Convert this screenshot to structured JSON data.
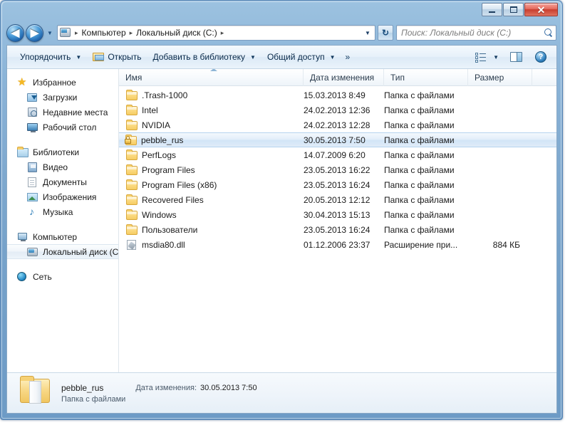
{
  "window": {
    "minimize_label": "–",
    "maximize_label": "",
    "close_label": "✕"
  },
  "address_bar": {
    "back_label": "◀",
    "forward_label": "▶",
    "recent_caret": "▼",
    "crumbs": [
      {
        "label": "Компьютер"
      },
      {
        "label": "Локальный диск (C:)"
      }
    ],
    "separator": "▸",
    "dropdown_caret": "▼",
    "refresh_label": "↻"
  },
  "search": {
    "placeholder": "Поиск: Локальный диск (C:)",
    "value": ""
  },
  "toolbar": {
    "organize_label": "Упорядочить",
    "open_label": "Открыть",
    "add_to_library_label": "Добавить в библиотеку",
    "share_label": "Общий доступ",
    "overflow_label": "»",
    "caret": "▼",
    "help_label": "?"
  },
  "navigation_pane": {
    "groups": [
      {
        "header": {
          "label": "Избранное",
          "icon": "star-icon"
        },
        "items": [
          {
            "label": "Загрузки",
            "icon": "downloads-icon"
          },
          {
            "label": "Недавние места",
            "icon": "recent-places-icon"
          },
          {
            "label": "Рабочий стол",
            "icon": "desktop-icon"
          }
        ]
      },
      {
        "header": {
          "label": "Библиотеки",
          "icon": "library-icon"
        },
        "items": [
          {
            "label": "Видео",
            "icon": "video-icon"
          },
          {
            "label": "Документы",
            "icon": "documents-icon"
          },
          {
            "label": "Изображения",
            "icon": "pictures-icon"
          },
          {
            "label": "Музыка",
            "icon": "music-icon"
          }
        ]
      },
      {
        "header": {
          "label": "Компьютер",
          "icon": "computer-icon"
        },
        "items": [
          {
            "label": "Локальный диск (C",
            "icon": "disk-icon",
            "selected": true
          }
        ]
      },
      {
        "header": {
          "label": "Сеть",
          "icon": "network-icon"
        },
        "items": []
      }
    ]
  },
  "file_list": {
    "columns": [
      {
        "label": "Имя",
        "key": "name"
      },
      {
        "label": "Дата изменения",
        "key": "date"
      },
      {
        "label": "Тип",
        "key": "type"
      },
      {
        "label": "Размер",
        "key": "size"
      }
    ],
    "sorted_by": "name",
    "sort_direction": "ascending",
    "rows": [
      {
        "name": ".Trash-1000",
        "date": "15.03.2013 8:49",
        "type": "Папка с файлами",
        "size": "",
        "icon": "folder-icon",
        "selected": false
      },
      {
        "name": "Intel",
        "date": "24.02.2013 12:36",
        "type": "Папка с файлами",
        "size": "",
        "icon": "folder-icon",
        "selected": false
      },
      {
        "name": "NVIDIA",
        "date": "24.02.2013 12:28",
        "type": "Папка с файлами",
        "size": "",
        "icon": "folder-icon",
        "selected": false
      },
      {
        "name": "pebble_rus",
        "date": "30.05.2013 7:50",
        "type": "Папка с файлами",
        "size": "",
        "icon": "locked-folder-icon",
        "selected": true
      },
      {
        "name": "PerfLogs",
        "date": "14.07.2009 6:20",
        "type": "Папка с файлами",
        "size": "",
        "icon": "folder-icon",
        "selected": false
      },
      {
        "name": "Program Files",
        "date": "23.05.2013 16:22",
        "type": "Папка с файлами",
        "size": "",
        "icon": "folder-icon",
        "selected": false
      },
      {
        "name": "Program Files (x86)",
        "date": "23.05.2013 16:24",
        "type": "Папка с файлами",
        "size": "",
        "icon": "folder-icon",
        "selected": false
      },
      {
        "name": "Recovered Files",
        "date": "20.05.2013 12:12",
        "type": "Папка с файлами",
        "size": "",
        "icon": "folder-icon",
        "selected": false
      },
      {
        "name": "Windows",
        "date": "30.04.2013 15:13",
        "type": "Папка с файлами",
        "size": "",
        "icon": "folder-icon",
        "selected": false
      },
      {
        "name": "Пользователи",
        "date": "23.05.2013 16:24",
        "type": "Папка с файлами",
        "size": "",
        "icon": "folder-icon",
        "selected": false
      },
      {
        "name": "msdia80.dll",
        "date": "01.12.2006 23:37",
        "type": "Расширение при...",
        "size": "884 КБ",
        "icon": "dll-icon",
        "selected": false
      }
    ]
  },
  "details_pane": {
    "name": "pebble_rus",
    "type": "Папка с файлами",
    "meta_label": "Дата изменения:",
    "meta_value": "30.05.2013 7:50",
    "icon": "folder-icon-large"
  },
  "colors": {
    "accent": "#2f7fb8",
    "selection_border": "#b5d3ef",
    "close_button": "#c83d2e",
    "frame": "#7fa9cf"
  }
}
